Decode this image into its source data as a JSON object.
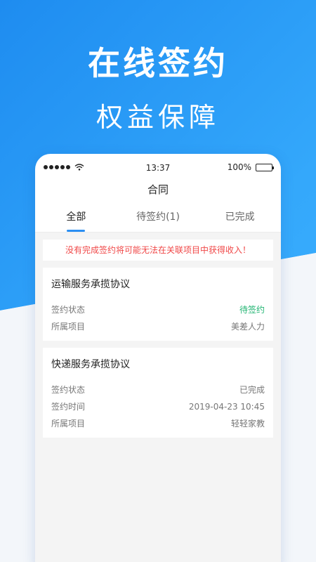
{
  "promo": {
    "headline": "在线签约",
    "subline": "权益保障"
  },
  "status_bar": {
    "time": "13:37",
    "battery": "100%"
  },
  "nav": {
    "title": "合同"
  },
  "tabs": [
    {
      "label": "全部"
    },
    {
      "label": "待签约(1)"
    },
    {
      "label": "已完成"
    }
  ],
  "notice": "没有完成签约将可能无法在关联项目中获得收入！",
  "contracts": [
    {
      "title": "运输服务承揽协议",
      "rows": [
        {
          "label": "签约状态",
          "value": "待签约"
        },
        {
          "label": "所属项目",
          "value": "美差人力"
        }
      ]
    },
    {
      "title": "快递服务承揽协议",
      "rows": [
        {
          "label": "签约状态",
          "value": "已完成"
        },
        {
          "label": "签约时间",
          "value": "2019-04-23  10:45"
        },
        {
          "label": "所属项目",
          "value": "轻轻家教"
        }
      ]
    }
  ],
  "colors": {
    "accent": "#2b8ff3",
    "pending": "#22b573",
    "warning": "#f04848"
  }
}
